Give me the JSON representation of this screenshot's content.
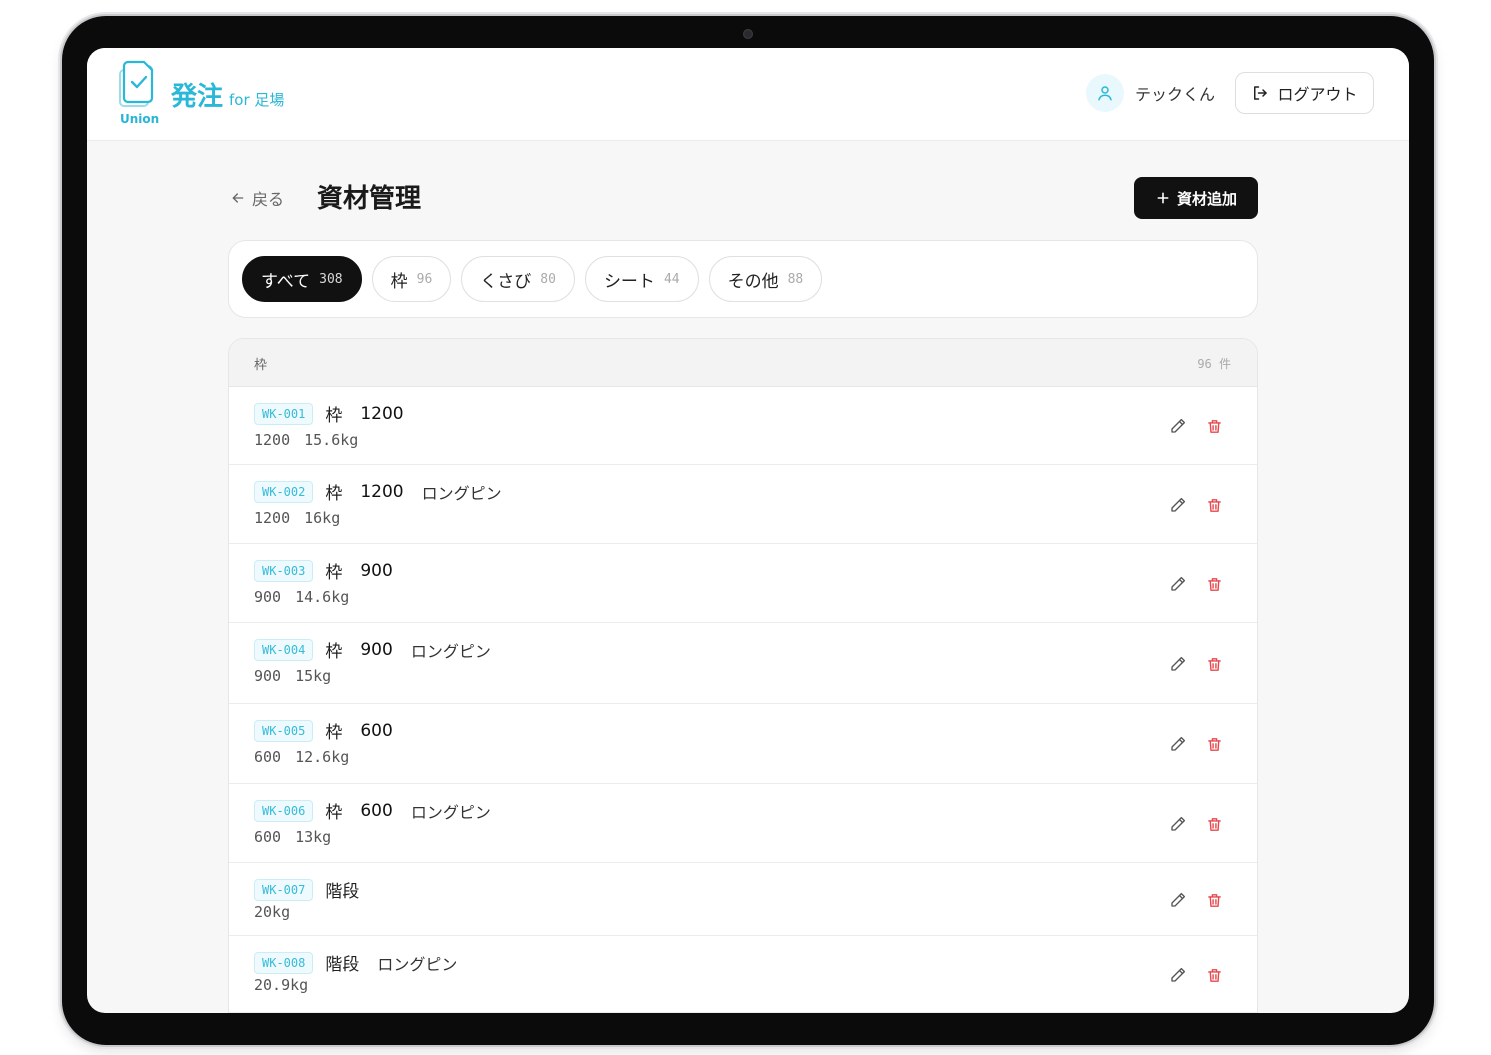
{
  "brand": {
    "name": "発注",
    "suffix": "for 足場",
    "logo_text": "Union"
  },
  "user": {
    "name": "テックくん",
    "logout_label": "ログアウト"
  },
  "page": {
    "back_label": "戻る",
    "title": "資材管理",
    "add_label": "資材追加"
  },
  "filters": [
    {
      "label": "すべて",
      "count": "308",
      "active": true
    },
    {
      "label": "枠",
      "count": "96",
      "active": false
    },
    {
      "label": "くさび",
      "count": "80",
      "active": false
    },
    {
      "label": "シート",
      "count": "44",
      "active": false
    },
    {
      "label": "その他",
      "count": "88",
      "active": false
    }
  ],
  "table": {
    "category": "枠",
    "total": "96 件",
    "rows": [
      {
        "code": "WK-001",
        "name": "枠",
        "size": "1200",
        "option": "",
        "spec": "1200",
        "weight": "15.6kg"
      },
      {
        "code": "WK-002",
        "name": "枠",
        "size": "1200",
        "option": "ロングピン",
        "spec": "1200",
        "weight": "16kg"
      },
      {
        "code": "WK-003",
        "name": "枠",
        "size": "900",
        "option": "",
        "spec": "900",
        "weight": "14.6kg"
      },
      {
        "code": "WK-004",
        "name": "枠",
        "size": "900",
        "option": "ロングピン",
        "spec": "900",
        "weight": "15kg"
      },
      {
        "code": "WK-005",
        "name": "枠",
        "size": "600",
        "option": "",
        "spec": "600",
        "weight": "12.6kg"
      },
      {
        "code": "WK-006",
        "name": "枠",
        "size": "600",
        "option": "ロングピン",
        "spec": "600",
        "weight": "13kg"
      },
      {
        "code": "WK-007",
        "name": "階段",
        "size": "",
        "option": "",
        "spec": "",
        "weight": "20kg"
      },
      {
        "code": "WK-008",
        "name": "階段",
        "size": "",
        "option": "ロングピン",
        "spec": "",
        "weight": "20.9kg"
      }
    ]
  },
  "icons": {
    "edit": "pencil-icon",
    "delete": "trash-icon",
    "back": "arrow-left-icon",
    "add": "plus-icon",
    "logout": "logout-icon",
    "user": "user-icon"
  },
  "colors": {
    "accent": "#2ab8d8",
    "danger": "#e5484d",
    "primary": "#111111"
  }
}
